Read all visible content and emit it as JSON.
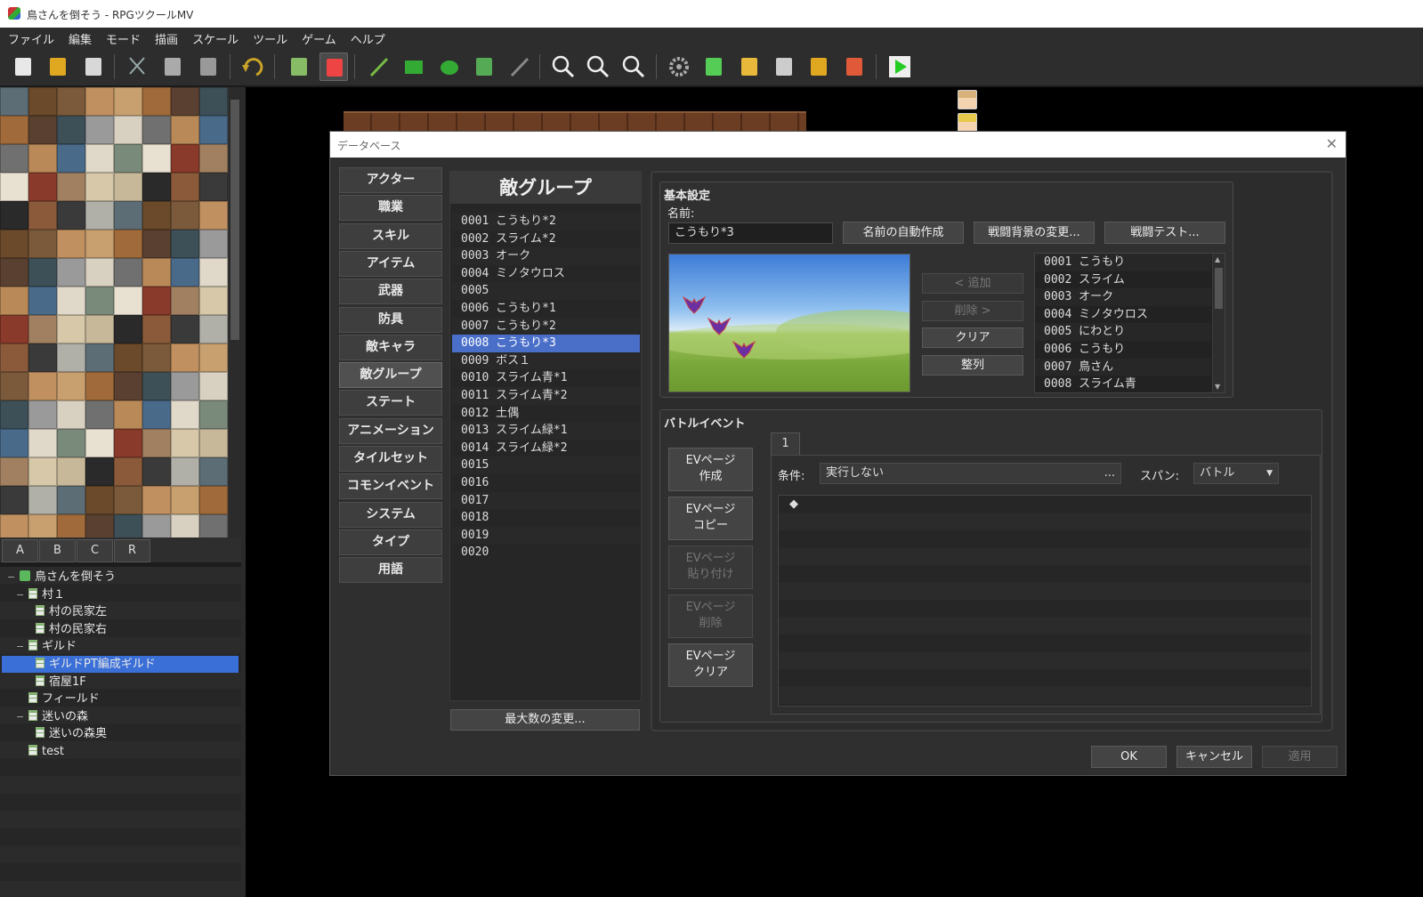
{
  "window": {
    "title": "鳥さんを倒そう - RPGツクールMV"
  },
  "menu": [
    "ファイル",
    "編集",
    "モード",
    "描画",
    "スケール",
    "ツール",
    "ゲーム",
    "ヘルプ"
  ],
  "toolbar": [
    {
      "name": "new-project-icon",
      "color": "#e8e8e8"
    },
    {
      "name": "open-project-icon",
      "color": "#e0a820"
    },
    {
      "name": "save-project-icon",
      "color": "#d8d8d8"
    },
    {
      "name": "cut-icon",
      "color": "#9aa"
    },
    {
      "name": "copy-icon",
      "color": "#aaa"
    },
    {
      "name": "paste-icon",
      "color": "#999"
    },
    {
      "name": "undo-icon",
      "color": "#c9a227"
    },
    {
      "name": "map-mode-icon",
      "color": "#8b6"
    },
    {
      "name": "event-mode-icon",
      "color": "#e44"
    },
    {
      "name": "pencil-icon",
      "color": "#7b4"
    },
    {
      "name": "rectangle-icon",
      "color": "#3a3"
    },
    {
      "name": "ellipse-icon",
      "color": "#3a3"
    },
    {
      "name": "fill-icon",
      "color": "#5a5"
    },
    {
      "name": "shadow-pen-icon",
      "color": "#888"
    },
    {
      "name": "zoom-in-icon",
      "color": "#eee"
    },
    {
      "name": "zoom-out-icon",
      "color": "#eee"
    },
    {
      "name": "zoom-actual-icon",
      "color": "#eee"
    },
    {
      "name": "database-icon",
      "color": "#aaa"
    },
    {
      "name": "plugin-manager-icon",
      "color": "#5c5"
    },
    {
      "name": "sound-test-icon",
      "color": "#e8b83a"
    },
    {
      "name": "event-searcher-icon",
      "color": "#ccc"
    },
    {
      "name": "resource-manager-icon",
      "color": "#e0a820"
    },
    {
      "name": "character-generator-icon",
      "color": "#e05a3a"
    },
    {
      "name": "playtest-icon",
      "color": "#2c2"
    }
  ],
  "tile_tabs": [
    "A",
    "B",
    "C",
    "R"
  ],
  "map_tree": [
    {
      "label": "鳥さんを倒そう",
      "level": 0,
      "root": true,
      "expanded": true
    },
    {
      "label": "村１",
      "level": 1,
      "expanded": true
    },
    {
      "label": "村の民家左",
      "level": 2
    },
    {
      "label": "村の民家右",
      "level": 2
    },
    {
      "label": "ギルド",
      "level": 1,
      "expanded": true
    },
    {
      "label": "ギルドPT編成ギルド",
      "level": 2,
      "selected": true
    },
    {
      "label": "宿屋1F",
      "level": 2
    },
    {
      "label": "フィールド",
      "level": 1
    },
    {
      "label": "迷いの森",
      "level": 1,
      "expanded": true
    },
    {
      "label": "迷いの森奥",
      "level": 2
    },
    {
      "label": "test",
      "level": 1
    }
  ],
  "dialog": {
    "title": "データベース",
    "close": "✕",
    "categories": [
      "アクター",
      "職業",
      "スキル",
      "アイテム",
      "武器",
      "防具",
      "敵キャラ",
      "敵グループ",
      "ステート",
      "アニメーション",
      "タイルセット",
      "コモンイベント",
      "システム",
      "タイプ",
      "用語"
    ],
    "selected_category": "敵グループ",
    "troop_header": "敵グループ",
    "troops": [
      {
        "id": "0001",
        "name": "こうもり*2"
      },
      {
        "id": "0002",
        "name": "スライム*2"
      },
      {
        "id": "0003",
        "name": "オーク"
      },
      {
        "id": "0004",
        "name": "ミノタウロス"
      },
      {
        "id": "0005",
        "name": ""
      },
      {
        "id": "0006",
        "name": "こうもり*1"
      },
      {
        "id": "0007",
        "name": "こうもり*2"
      },
      {
        "id": "0008",
        "name": "こうもり*3",
        "selected": true
      },
      {
        "id": "0009",
        "name": "ボス１"
      },
      {
        "id": "0010",
        "name": "スライム青*1"
      },
      {
        "id": "0011",
        "name": "スライム青*2"
      },
      {
        "id": "0012",
        "name": "土偶"
      },
      {
        "id": "0013",
        "name": "スライム緑*1"
      },
      {
        "id": "0014",
        "name": "スライム緑*2"
      },
      {
        "id": "0015",
        "name": ""
      },
      {
        "id": "0016",
        "name": ""
      },
      {
        "id": "0017",
        "name": ""
      },
      {
        "id": "0018",
        "name": ""
      },
      {
        "id": "0019",
        "name": ""
      },
      {
        "id": "0020",
        "name": ""
      }
    ],
    "change_max_label": "最大数の変更...",
    "basic": {
      "group_label": "基本設定",
      "name_label": "名前:",
      "name_value": "こうもり*3",
      "auto_name": "名前の自動作成",
      "change_bg": "戦闘背景の変更...",
      "battle_test": "戦闘テスト...",
      "add": "< 追加",
      "remove": "削除 >",
      "clear": "クリア",
      "align": "整列"
    },
    "enemies": [
      {
        "id": "0001",
        "name": "こうもり"
      },
      {
        "id": "0002",
        "name": "スライム"
      },
      {
        "id": "0003",
        "name": "オーク"
      },
      {
        "id": "0004",
        "name": "ミノタウロス"
      },
      {
        "id": "0005",
        "name": "にわとり"
      },
      {
        "id": "0006",
        "name": "こうもり"
      },
      {
        "id": "0007",
        "name": "鳥さん"
      },
      {
        "id": "0008",
        "name": "スライム青"
      }
    ],
    "battle_event": {
      "group_label": "バトルイベント",
      "page_tab": "1",
      "buttons": [
        {
          "line1": "EVページ",
          "line2": "作成",
          "enabled": true
        },
        {
          "line1": "EVページ",
          "line2": "コピー",
          "enabled": true
        },
        {
          "line1": "EVページ",
          "line2": "貼り付け",
          "enabled": false
        },
        {
          "line1": "EVページ",
          "line2": "削除",
          "enabled": false
        },
        {
          "line1": "EVページ",
          "line2": "クリア",
          "enabled": true
        }
      ],
      "condition_label": "条件:",
      "condition_value": "実行しない",
      "condition_more": "...",
      "span_label": "スパン:",
      "span_value": "バトル",
      "list_marker": "◆"
    },
    "ok": "OK",
    "cancel": "キャンセル",
    "apply": "適用"
  }
}
